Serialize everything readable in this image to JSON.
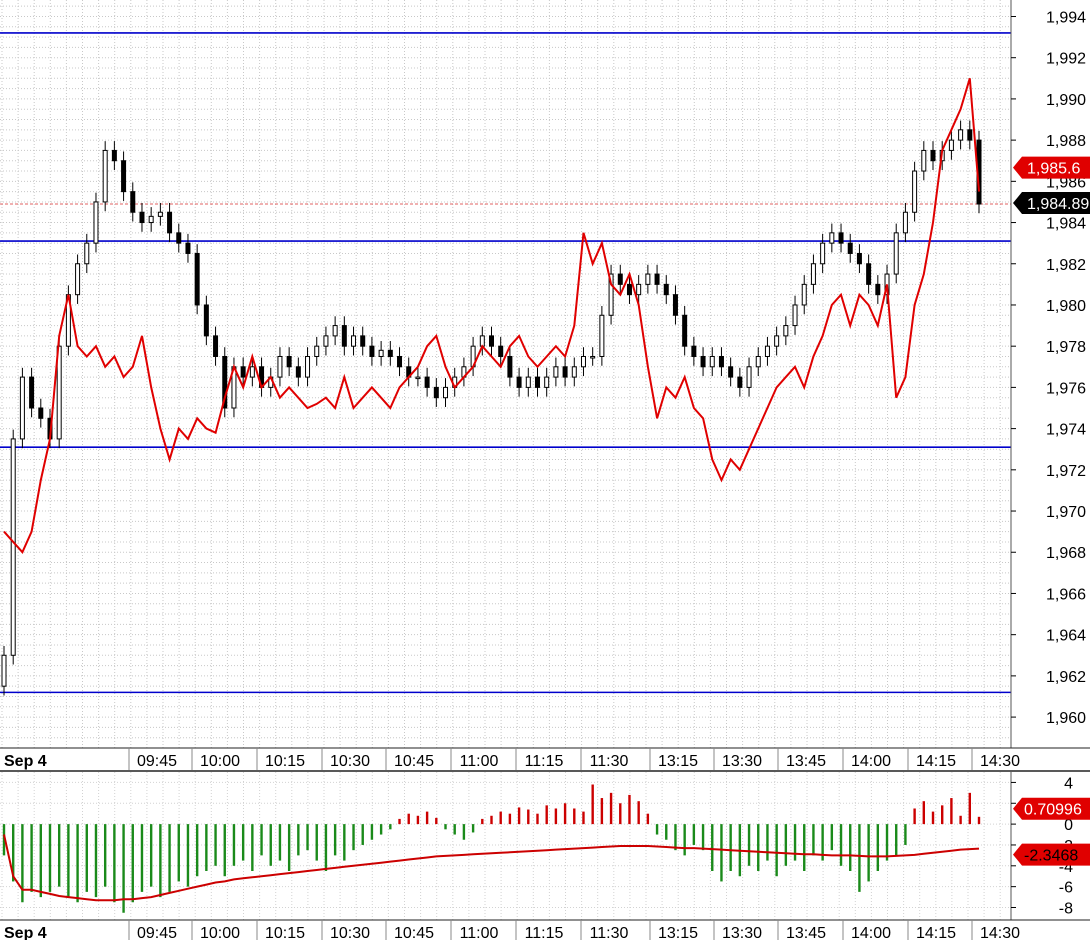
{
  "chart_data": [
    {
      "type": "candlestick",
      "panel": "price",
      "title": "",
      "xlabel": "",
      "ylabel": "",
      "ylim": [
        1958.5,
        1994.8
      ],
      "y_ticks": [
        1960,
        1962,
        1964,
        1966,
        1968,
        1970,
        1972,
        1974,
        1976,
        1978,
        1980,
        1982,
        1984,
        1986,
        1988,
        1990,
        1992,
        1994
      ],
      "x_tick_labels": [
        "09:45",
        "10:00",
        "10:15",
        "10:30",
        "10:45",
        "11:00",
        "11:15",
        "11:30",
        "13:15",
        "13:30",
        "13:45",
        "14:00",
        "14:15",
        "14:30"
      ],
      "date_label": "Sep 4",
      "grid": true,
      "horizontal_levels": [
        1993.2,
        1983.1,
        1973.1,
        1961.2
      ],
      "colors": {
        "levels": "#0000cc",
        "overlay_line": "#e00000",
        "bull_candle": "#ffffff",
        "bear_candle": "#000000",
        "grid": "#bdbdbd"
      },
      "dotted_reference": 1984.9,
      "price_badges": [
        {
          "label": "1,985.6",
          "color": "#e00000"
        },
        {
          "label": "1,984.89",
          "color": "#000000"
        }
      ],
      "closes": [
        1963.0,
        1973.5,
        1976.5,
        1975.0,
        1974.5,
        1973.5,
        1978.0,
        1980.5,
        1982.0,
        1983.0,
        1985.0,
        1987.5,
        1987.0,
        1985.5,
        1984.5,
        1984.0,
        1984.3,
        1984.5,
        1983.5,
        1983.0,
        1982.5,
        1980.0,
        1978.5,
        1977.5,
        1975.0,
        1977.0,
        1976.5,
        1977.0,
        1976.0,
        1976.5,
        1977.5,
        1977.0,
        1976.5,
        1977.5,
        1978.0,
        1978.5,
        1979.0,
        1978.0,
        1978.5,
        1978.0,
        1977.5,
        1977.8,
        1977.5,
        1977.0,
        1976.5,
        1976.5,
        1976.0,
        1975.5,
        1976.0,
        1976.5,
        1977.0,
        1978.0,
        1978.5,
        1978.0,
        1977.5,
        1976.5,
        1976.0,
        1976.5,
        1976.0,
        1976.5,
        1977.0,
        1976.5,
        1977.0,
        1977.5,
        1977.5,
        1979.5,
        1981.5,
        1981.0,
        1980.5,
        1981.0,
        1981.5,
        1981.0,
        1980.5,
        1979.5,
        1978.0,
        1977.5,
        1977.0,
        1977.5,
        1977.0,
        1976.5,
        1976.0,
        1977.0,
        1977.5,
        1978.0,
        1978.5,
        1979.0,
        1980.0,
        1981.0,
        1982.0,
        1983.0,
        1983.5,
        1983.0,
        1982.5,
        1982.0,
        1981.0,
        1980.5,
        1981.5,
        1983.5,
        1984.5,
        1986.5,
        1987.5,
        1987.0,
        1987.5,
        1988.0,
        1988.5,
        1988.0,
        1984.9
      ],
      "overlay_line": [
        1969.0,
        1968.5,
        1968.0,
        1969.0,
        1971.5,
        1973.5,
        1978.5,
        1980.5,
        1978.0,
        1977.5,
        1978.0,
        1977.0,
        1977.5,
        1976.5,
        1977.0,
        1978.5,
        1976.0,
        1974.0,
        1972.5,
        1974.0,
        1973.5,
        1974.5,
        1974.0,
        1973.8,
        1975.5,
        1977.0,
        1976.0,
        1977.5,
        1976.0,
        1976.5,
        1975.5,
        1976.0,
        1975.5,
        1975.0,
        1975.2,
        1975.5,
        1975.0,
        1976.5,
        1975.0,
        1975.5,
        1976.0,
        1975.5,
        1975.0,
        1976.0,
        1976.5,
        1977.0,
        1978.0,
        1978.5,
        1977.0,
        1976.0,
        1976.5,
        1977.0,
        1978.0,
        1977.5,
        1977.0,
        1978.0,
        1978.5,
        1977.5,
        1977.0,
        1977.5,
        1978.0,
        1977.5,
        1979.0,
        1983.5,
        1982.0,
        1983.0,
        1981.0,
        1980.5,
        1981.5,
        1980.0,
        1977.0,
        1974.5,
        1976.0,
        1975.5,
        1976.5,
        1975.0,
        1974.5,
        1972.5,
        1971.5,
        1972.5,
        1972.0,
        1973.0,
        1974.0,
        1975.0,
        1976.0,
        1976.5,
        1977.0,
        1976.0,
        1977.5,
        1978.5,
        1980.0,
        1980.5,
        1979.0,
        1980.5,
        1980.0,
        1979.0,
        1981.0,
        1975.5,
        1976.5,
        1980.0,
        1981.5,
        1984.0,
        1987.5,
        1988.5,
        1989.5,
        1991.0,
        1985.5
      ]
    },
    {
      "type": "histogram",
      "panel": "oscillator",
      "title": "",
      "xlabel": "",
      "ylabel": "",
      "ylim": [
        -9.2,
        5.0
      ],
      "y_ticks": [
        4,
        2,
        0,
        -2,
        -4,
        -6,
        -8
      ],
      "x_tick_labels": [
        "09:45",
        "10:00",
        "10:15",
        "10:30",
        "10:45",
        "11:00",
        "11:15",
        "11:30",
        "13:15",
        "13:30",
        "13:45",
        "14:00",
        "14:15",
        "14:30"
      ],
      "date_label": "Sep 4",
      "colors": {
        "positive": "#cc0000",
        "negative": "#1a8a1a",
        "signal_line": "#cc0000"
      },
      "value_badges": [
        {
          "label": "0.70996",
          "color": "#e00000"
        },
        {
          "label": "-2.3468",
          "color": "#e00000"
        }
      ],
      "histogram": [
        -3.0,
        -5.5,
        -7.5,
        -6.5,
        -7.0,
        -6.5,
        -6.0,
        -7.0,
        -7.5,
        -6.5,
        -7.0,
        -6.0,
        -7.5,
        -8.5,
        -7.5,
        -6.5,
        -6.0,
        -7.0,
        -6.5,
        -5.5,
        -6.0,
        -5.0,
        -4.5,
        -4.0,
        -5.0,
        -4.0,
        -3.5,
        -4.5,
        -3.0,
        -4.0,
        -3.5,
        -4.5,
        -3.0,
        -2.5,
        -3.5,
        -4.5,
        -3.0,
        -3.5,
        -2.5,
        -2.0,
        -1.5,
        -1.0,
        -0.5,
        0.5,
        1.0,
        0.8,
        1.2,
        0.6,
        -0.5,
        -1.0,
        -1.5,
        -0.8,
        0.5,
        0.8,
        1.2,
        1.0,
        1.6,
        1.4,
        1.0,
        1.8,
        1.5,
        2.0,
        1.5,
        1.2,
        3.8,
        2.5,
        3.0,
        2.0,
        2.8,
        2.2,
        1.0,
        -1.0,
        -1.5,
        -2.5,
        -3.0,
        -2.0,
        -2.5,
        -4.5,
        -5.5,
        -4.5,
        -5.0,
        -4.0,
        -4.5,
        -3.5,
        -5.0,
        -4.0,
        -3.5,
        -4.5,
        -3.0,
        -3.5,
        -2.5,
        -4.0,
        -4.5,
        -6.5,
        -5.5,
        -4.5,
        -3.5,
        -3.0,
        -2.0,
        1.5,
        2.2,
        1.2,
        1.8,
        2.5,
        0.8,
        3.0,
        0.7
      ],
      "signal_line": [
        -1.0,
        -5.0,
        -6.3,
        -6.3,
        -6.5,
        -6.7,
        -6.9,
        -7.0,
        -7.1,
        -7.2,
        -7.3,
        -7.3,
        -7.3,
        -7.2,
        -7.2,
        -7.1,
        -7.0,
        -6.8,
        -6.6,
        -6.4,
        -6.2,
        -6.0,
        -5.8,
        -5.6,
        -5.5,
        -5.3,
        -5.2,
        -5.1,
        -5.0,
        -4.9,
        -4.8,
        -4.7,
        -4.6,
        -4.5,
        -4.4,
        -4.3,
        -4.2,
        -4.1,
        -4.0,
        -3.9,
        -3.8,
        -3.7,
        -3.6,
        -3.5,
        -3.4,
        -3.3,
        -3.2,
        -3.1,
        -3.05,
        -3.0,
        -2.95,
        -2.9,
        -2.85,
        -2.8,
        -2.75,
        -2.7,
        -2.65,
        -2.6,
        -2.55,
        -2.5,
        -2.45,
        -2.4,
        -2.35,
        -2.3,
        -2.25,
        -2.2,
        -2.15,
        -2.1,
        -2.1,
        -2.1,
        -2.1,
        -2.15,
        -2.2,
        -2.25,
        -2.3,
        -2.3,
        -2.35,
        -2.4,
        -2.45,
        -2.5,
        -2.55,
        -2.6,
        -2.65,
        -2.7,
        -2.75,
        -2.8,
        -2.85,
        -2.9,
        -2.9,
        -2.95,
        -3.0,
        -3.0,
        -3.0,
        -3.05,
        -3.1,
        -3.1,
        -3.1,
        -3.05,
        -3.0,
        -2.95,
        -2.85,
        -2.75,
        -2.65,
        -2.55,
        -2.45,
        -2.4,
        -2.35
      ]
    }
  ]
}
